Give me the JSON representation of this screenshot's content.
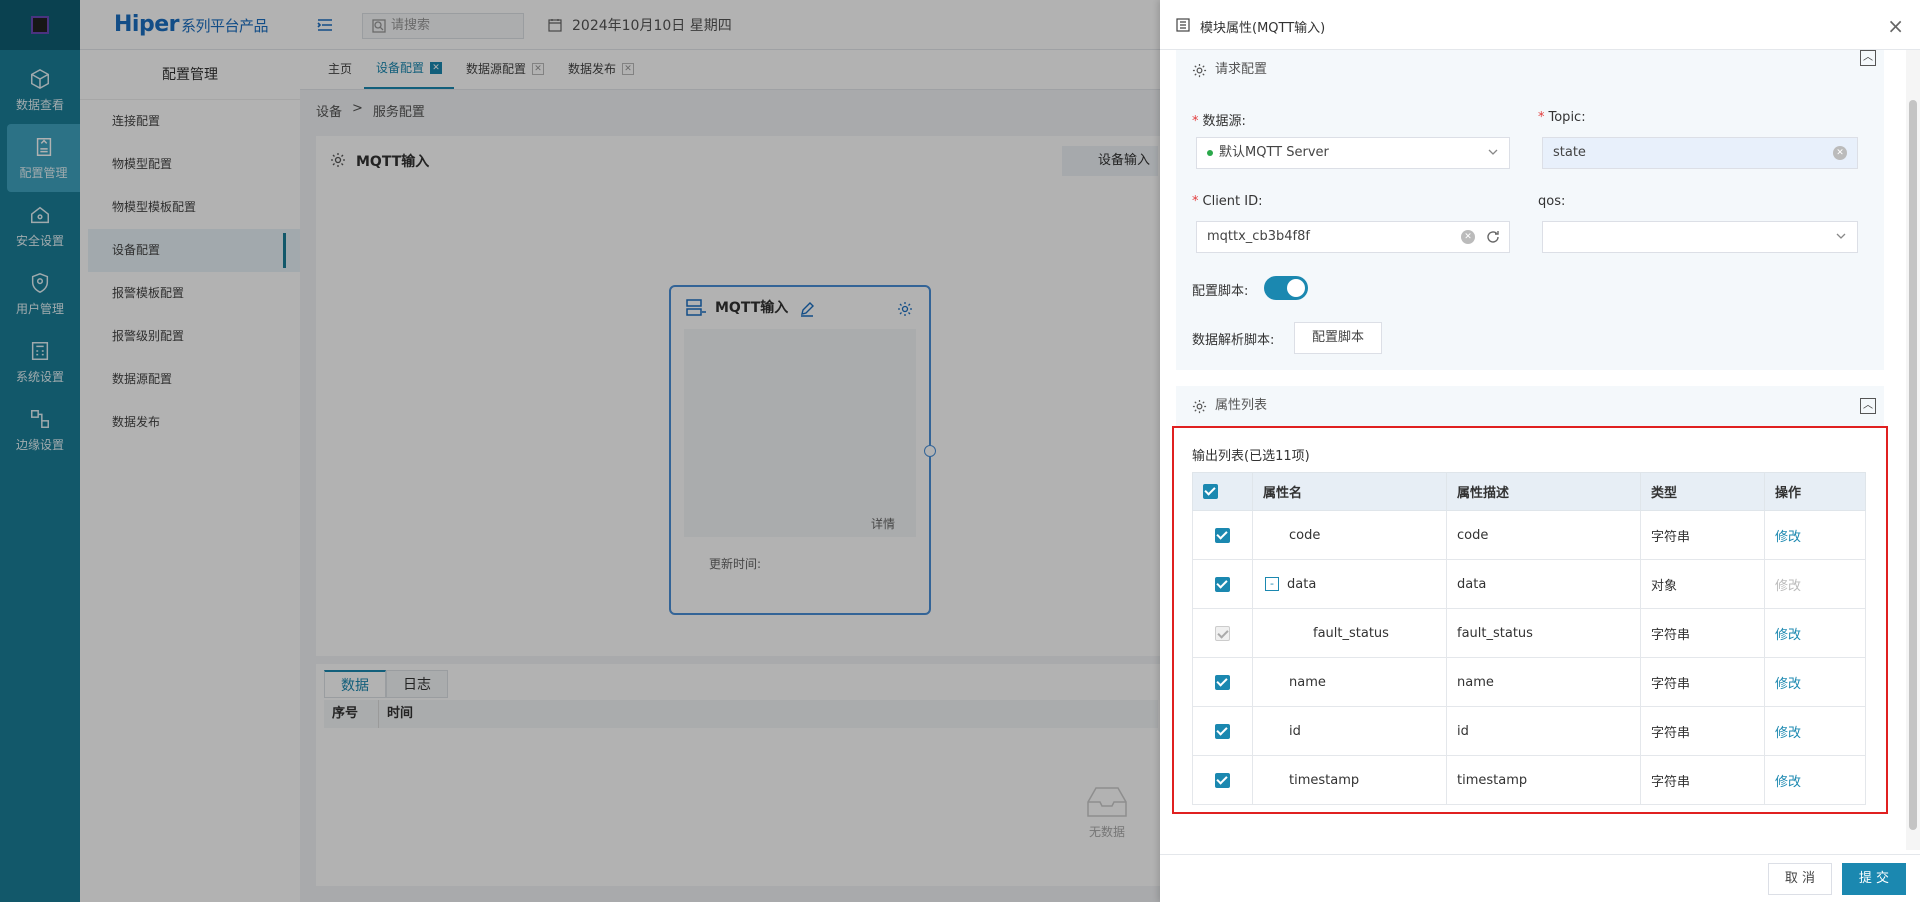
{
  "rail": [
    {
      "label": "数据查看",
      "icon": "cube-icon"
    },
    {
      "label": "配置管理",
      "icon": "document-icon"
    },
    {
      "label": "安全设置",
      "icon": "home-shield-icon"
    },
    {
      "label": "用户管理",
      "icon": "shield-user-icon"
    },
    {
      "label": "系统设置",
      "icon": "calculator-icon"
    },
    {
      "label": "边缘设置",
      "icon": "nodes-icon"
    }
  ],
  "brand": {
    "name": "Hiper",
    "suffix": "系列平台产品"
  },
  "search": {
    "placeholder": "请搜索"
  },
  "date": "2024年10月10日 星期四",
  "sidemenu": {
    "title": "配置管理",
    "items": [
      "连接配置",
      "物模型配置",
      "物模型模板配置",
      "设备配置",
      "报警模板配置",
      "报警级别配置",
      "数据源配置",
      "数据发布"
    ]
  },
  "tabs": [
    "主页",
    "设备配置",
    "数据源配置",
    "数据发布"
  ],
  "breadcrumb": {
    "first": "设备",
    "sep": ">",
    "second": "服务配置"
  },
  "canvas": {
    "title": "MQTT输入",
    "device_btn": "设备输入"
  },
  "node": {
    "title": "MQTT输入",
    "detail": "详情",
    "updated": "更新时间:"
  },
  "bottom": {
    "tab_data": "数据",
    "tab_log": "日志",
    "col_no": "序号",
    "col_time": "时间",
    "empty": "无数据"
  },
  "drawer": {
    "title": "模块属性(MQTT输入)",
    "close": "×",
    "request_section": "请求配置",
    "datasource_label": "数据源:",
    "datasource_value": "默认MQTT Server",
    "topic_label": "Topic:",
    "topic_value": "state",
    "clientid_label": "Client ID:",
    "clientid_value": "mqttx_cb3b4f8f",
    "qos_label": "qos:",
    "script_label": "配置脚本:",
    "parse_label": "数据解析脚本:",
    "parse_btn": "配置脚本",
    "attr_section": "属性列表",
    "output_label": "输出列表(已选11项)",
    "cols": {
      "name": "属性名",
      "desc": "属性描述",
      "type": "类型",
      "op": "操作"
    },
    "rows": [
      {
        "name": "code",
        "desc": "code",
        "type": "字符串",
        "op": "修改"
      },
      {
        "name": "data",
        "desc": "data",
        "type": "对象",
        "op": "修改"
      },
      {
        "name": "fault_status",
        "desc": "fault_status",
        "type": "字符串",
        "op": "修改"
      },
      {
        "name": "name",
        "desc": "name",
        "type": "字符串",
        "op": "修改"
      },
      {
        "name": "id",
        "desc": "id",
        "type": "字符串",
        "op": "修改"
      },
      {
        "name": "timestamp",
        "desc": "timestamp",
        "type": "字符串",
        "op": "修改"
      }
    ],
    "cancel": "取 消",
    "submit": "提 交"
  },
  "colors": {
    "accent": "#1b88b0",
    "rail": "#1a7f99",
    "highlight": "#e02020"
  }
}
